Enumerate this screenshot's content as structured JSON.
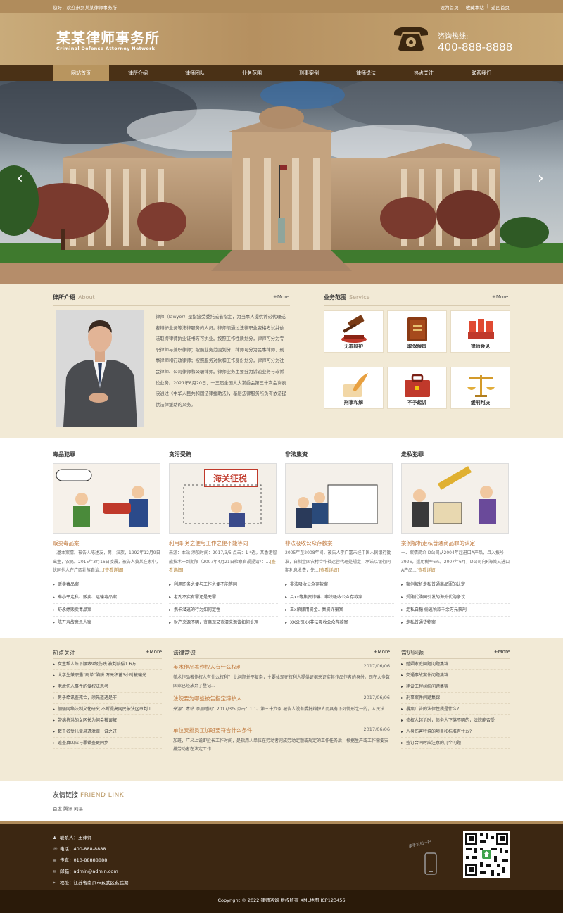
{
  "topbar": {
    "welcome": "您好，欢迎来到某某律师事务所！",
    "links": [
      "设为首页",
      "收藏本站",
      "返回首页"
    ]
  },
  "header": {
    "name_cn": "某某律师事务所",
    "name_en": "Criminal Defense Attorney Network",
    "hotline_label": "咨询热线:",
    "hotline": "400-888-8888"
  },
  "nav": {
    "items": [
      "网站首页",
      "律所介绍",
      "律师团队",
      "业务范围",
      "刑事案例",
      "律师说法",
      "热点关注",
      "联系我们"
    ]
  },
  "banner": {
    "prev": "‹",
    "next": "›"
  },
  "about": {
    "title": "律所介绍",
    "title_en": "About",
    "more": "+More",
    "text": "律师（lawyer）是指接受委托或者指定，为当事人提供诉讼代理或者辩护业务等法律服务的人员。律师须通过法律职业资格考试并依法取得律师执业证书方可执业。按照工作性质划分，律师可分为专职律师与兼职律师；按照业务范围划分，律师可分为民事律师、刑事律师和行政律师；按照服务对象和工作身份划分，律师可分为社会律师、公司律师和公职律师。律师业务主要分为诉讼业务与非诉讼业务。2021年8月20日，十三届全国人大常委会第三十次会议表决通过《中华人民共和国法律援助法》，基层法律服务所负有依法提供法律援助的义务。"
  },
  "service": {
    "title": "业务范围",
    "title_en": "Service",
    "more": "+More",
    "items": [
      "无罪辩护",
      "取保候审",
      "律师会见",
      "刑事和解",
      "不予起诉",
      "缓刑判决"
    ]
  },
  "cases": [
    {
      "category": "毒品犯罪",
      "title": "贩卖毒品案",
      "summary": "【基本案情】被告人陈述友，男，汉族，1992年12月9日出生，农民。2015年3月16日凌晨，被告人黄某在家中，伙同他人在广西壮族自治...",
      "detail": "[查看详细]",
      "list": [
        "贩卖毒品案",
        "奉小平走私、贩卖、运输毒品案",
        "舒永婷贩卖毒品案",
        "陈万寿故意杀人案"
      ]
    },
    {
      "category": "贪污受贿",
      "title": "利用职务之便与工作之便不能等同",
      "summary": "来源：本站 添加时间：2017/3/5 点击：1 *近。某香港智能技术一到期限（2007年4月21日检察官规提请）：...",
      "detail": "[查看详细]",
      "list": [
        "利用职务之便与工作之便不能等同",
        "老孔不实有罪还是无罪",
        "携卡潜逃的行为如何定性",
        "财产来源不明，贪腐现又查清来源该如何处理"
      ]
    },
    {
      "category": "非法集资",
      "title": "非法吸收公众存款案",
      "summary": "2005年至2008年间，被告人李广富未经中国人民银行批准，自制金国农村合作社运营代理处规定，承诺以银行同期利息收费，先...",
      "detail": "[查看详细]",
      "list": [
        "非法吸收公众存款案",
        "吕xx等集资诈骗、非法吸收公众存款案",
        "王x荣挪用资金、集资诈骗案",
        "XX公司XX非法吸收公众存款案"
      ]
    },
    {
      "category": "走私犯罪",
      "title": "案例解析走私普通商品罪的认定",
      "summary": "一、案情简介 D公司从2004年起进口A产品，且入报号3926，适用税率6%。2007年6月，D公司向P海关又进口A产品...",
      "detail": "[查看详细]",
      "list": [
        "案例解析走私普通商品罪的认定",
        "受贿代购国引发的海外代购争议",
        "走私白糖 偷逃税款千余万元获刑",
        "走私普通货物案"
      ]
    }
  ],
  "hot": {
    "title": "热点关注",
    "more": "+More",
    "items": [
      "女生帮人练下腰致9级伤残 被判赔偿1.6万",
      "大学生兼职遇“刷单”陷阱 万元积蓄3小时被骗光",
      "老虎伤人事件的侵权法思考",
      "男子牵讯查死亡，须先道遇是非",
      "加强网络法制文化研究 不断提高网民依法区审判工",
      "带病抗洪的女区长为何会被误解",
      "数千名受儿童悬遭泄露，谁之过",
      "追查真凶应与罪错查更同步"
    ]
  },
  "law": {
    "title": "法律常识",
    "more": "+More",
    "items": [
      {
        "title": "美术作品著作权人有什么权利",
        "date": "2017/06/06",
        "summary": "美术作品著作权人有什么权利？ 此问题并不复杂，主要体现在权利人提供证据来证实其作品作者的身份。司在大多数国家已经放弃了登记..."
      },
      {
        "title": "法院要为哪些被告指定辩护人",
        "date": "2017/06/06",
        "summary": "来源：本站 添加时间：2017/3/5 点击：1 1、第三十六条 被告人没有委托辩护人而具有下列情形之一的，人民法..."
      },
      {
        "title": "单位安排员工加班要符合什么条件",
        "date": "2017/06/06",
        "summary": "加班，广义上说即延长工作时间，是指用人单位在劳动者完成劳动定额或规定的工作任务后，根据生产或工作需要安排劳动者在法定工作..."
      }
    ]
  },
  "faq": {
    "title": "常见问题",
    "more": "+More",
    "items": [
      "婚姻家庭问题问题集锦",
      "交通事故案件问题集锦",
      "建设工程纠纷问题集锦",
      "刑事案件问题集锦",
      "暴案广告的法律性质是什么?",
      "债权人起诉时，债务人下落不明的，法院能否受",
      "人身伤害特殊的项目和标准有什么?",
      "签订合同时应注意的几个问题"
    ]
  },
  "friend": {
    "title": "友情链接",
    "title_en": "FRIEND LINK",
    "links": "百度 腾讯 网易"
  },
  "footer": {
    "contact": "联系人：王律师",
    "phone": "电话：400-888-8888",
    "fax": "传真：010-88888888",
    "email": "邮箱：admin@admin.com",
    "address": "地址：江苏省南京市玄武区玄武湖",
    "mobile_text": "拿手机扫一扫",
    "copyright": "Copyright © 2022 律师咨询 版权所有 XML地图 ICP123456"
  },
  "colors": {
    "brand": "#b08c5c",
    "nav": "#4a3116",
    "accent": "#c0783c",
    "footer": "#3c2712"
  }
}
